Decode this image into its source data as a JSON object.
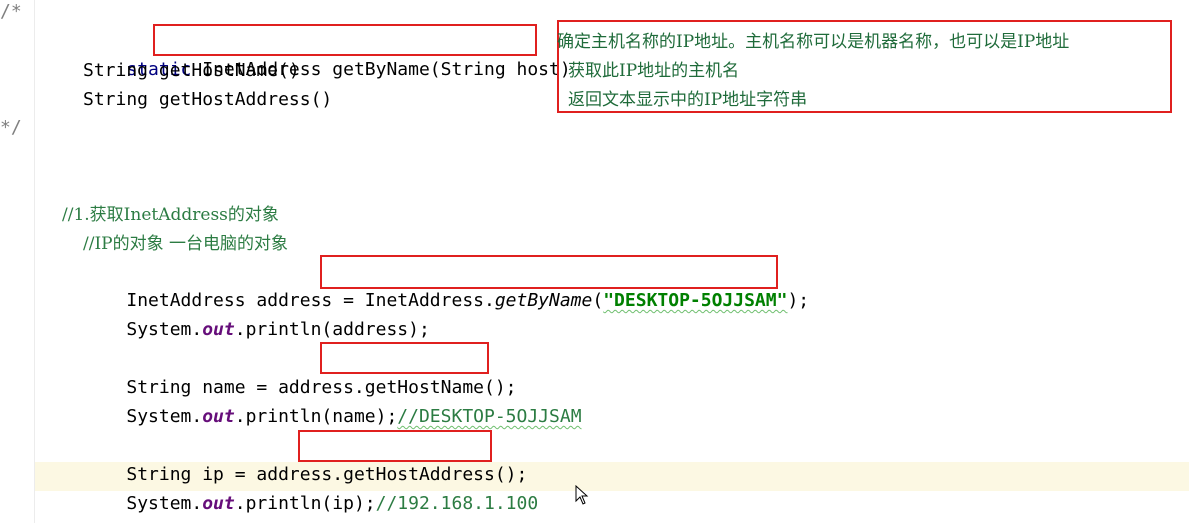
{
  "gutter": {
    "marks": [
      "/*",
      "*/"
    ]
  },
  "doc": {
    "line1": {
      "kw": "static",
      "sig": "InetAddress getByName(String host)"
    },
    "line2": "String getHostName()",
    "line3": "String getHostAddress()",
    "annotations": [
      "确定主机名称的IP地址。主机名称可以是机器名称，也可以是IP地址",
      "获取此IP地址的主机名",
      "返回文本显示中的IP地址字符串"
    ]
  },
  "code": {
    "comment1": "//1.获取InetAddress的对象",
    "comment2": "//IP的对象 一台电脑的对象",
    "decl_prefix": "InetAddress address = ",
    "decl_call_class": "InetAddress.",
    "decl_call_method": "getByName",
    "decl_open": "(",
    "decl_string": "\"DESKTOP-5OJJSAM\"",
    "decl_close": ");",
    "println_prefix": "System.",
    "println_out": "out",
    "println1_suffix": ".println(address);",
    "name_prefix": "String name = address.",
    "name_call": "getHostName();",
    "println2_suffix": ".println(name);",
    "println2_comment": "//DESKTOP-5OJJSAM",
    "ip_prefix": "String ip = address.",
    "ip_call": "getHostAddress();",
    "println3_suffix": ".println(ip);",
    "println3_comment": "//192.168.1.100"
  },
  "colors": {
    "highlight_box": "#e0201f",
    "current_line": "#fcf8e3",
    "keyword": "#000080",
    "string": "#008000",
    "static_field": "#660e7a",
    "comment": "#808080"
  }
}
